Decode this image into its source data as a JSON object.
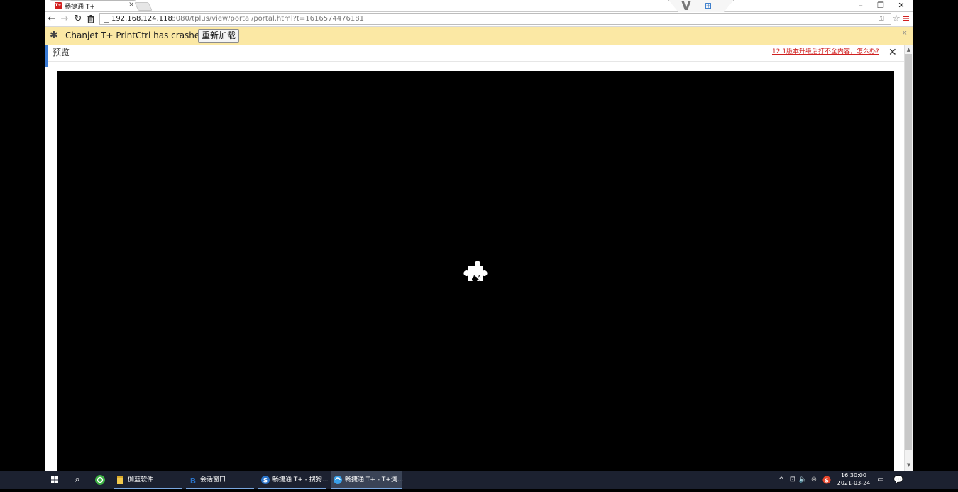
{
  "browser": {
    "tab": {
      "title": "畅捷通 T+",
      "favicon_text": "T+"
    },
    "address": {
      "host": "192.168.124.118",
      "rest": ":8080/tplus/view/portal/portal.html?t=1616574476181"
    },
    "icons": {
      "back": "←",
      "forward": "→",
      "reload": "↻",
      "trash": "🗑",
      "key": "⚿",
      "star": "☆",
      "menu": "≡",
      "tab_close": "×",
      "minimize": "–",
      "maximize": "❐",
      "close": "✕",
      "brand_v": "V",
      "brand_grid": "⊞"
    }
  },
  "infobar": {
    "message": "Chanjet T+ PrintCtrl has crashed.",
    "reload_button": "重新加载",
    "close_icon": "×",
    "puzzle_icon": "✱"
  },
  "preview": {
    "title": "预览",
    "upgrade_link": "12.1版本升级后打不全内容，怎么办?",
    "close_icon": "✕"
  },
  "scrollbar": {
    "up": "▲",
    "down": "▼"
  },
  "taskbar": {
    "search_icon": "⌕",
    "apps": [
      {
        "label": "伽蓝软件",
        "icon": "folder",
        "color": "#f2c94c"
      },
      {
        "label": "会话窗口",
        "icon": "chat",
        "color": "#2b73c8"
      },
      {
        "label": "畅捷通 T+ - 搜狗...",
        "icon": "sogou",
        "color": "#2b73c8"
      },
      {
        "label": "畅捷通 T+ - T+浏...",
        "icon": "browser",
        "color": "#3aa0e8"
      }
    ],
    "tray": {
      "chevron": "^",
      "network": "⊡",
      "volume": "🔈",
      "x_icon": "⊗",
      "sogou_s": "S",
      "time": "16:30:00",
      "date": "2021-03-24",
      "notification": "▭",
      "action_center": "💬"
    }
  },
  "colors": {
    "accent_red": "#d21f1f",
    "infobar_bg": "#fbe8a4",
    "taskbar_bg": "#1c2130",
    "link_red": "#d02020"
  }
}
